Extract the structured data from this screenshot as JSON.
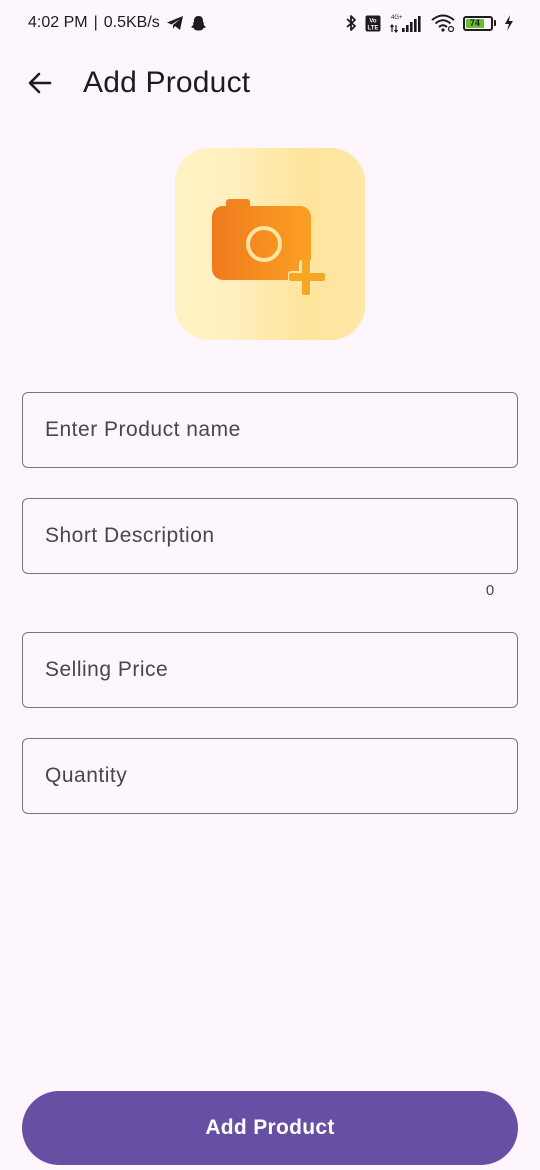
{
  "status_bar": {
    "time": "4:02 PM",
    "network_speed": "0.5KB/s",
    "network_type": "4G+",
    "volte_label": "Vo LTE",
    "battery_level": "74",
    "icons": [
      "telegram-icon",
      "snapchat-icon",
      "bluetooth-icon",
      "volte-icon",
      "signal-icon",
      "wifi-icon",
      "battery-icon",
      "charging-icon"
    ]
  },
  "app_bar": {
    "title": "Add Product",
    "back_icon": "arrow-left-icon"
  },
  "image_picker": {
    "icon": "camera-add-icon",
    "colors": {
      "camera": "#f5821f",
      "plus": "#f5a623",
      "background": "#ffefb8"
    }
  },
  "form": {
    "product_name": {
      "placeholder": "Enter Product name",
      "value": ""
    },
    "short_description": {
      "placeholder": "Short Description",
      "value": "",
      "counter": "0"
    },
    "selling_price": {
      "placeholder": "Selling Price",
      "value": ""
    },
    "quantity": {
      "placeholder": "Quantity",
      "value": ""
    }
  },
  "submit": {
    "label": "Add Product"
  },
  "colors": {
    "primary": "#6750a4",
    "background": "#fdf7fd",
    "outline": "#79747e"
  }
}
